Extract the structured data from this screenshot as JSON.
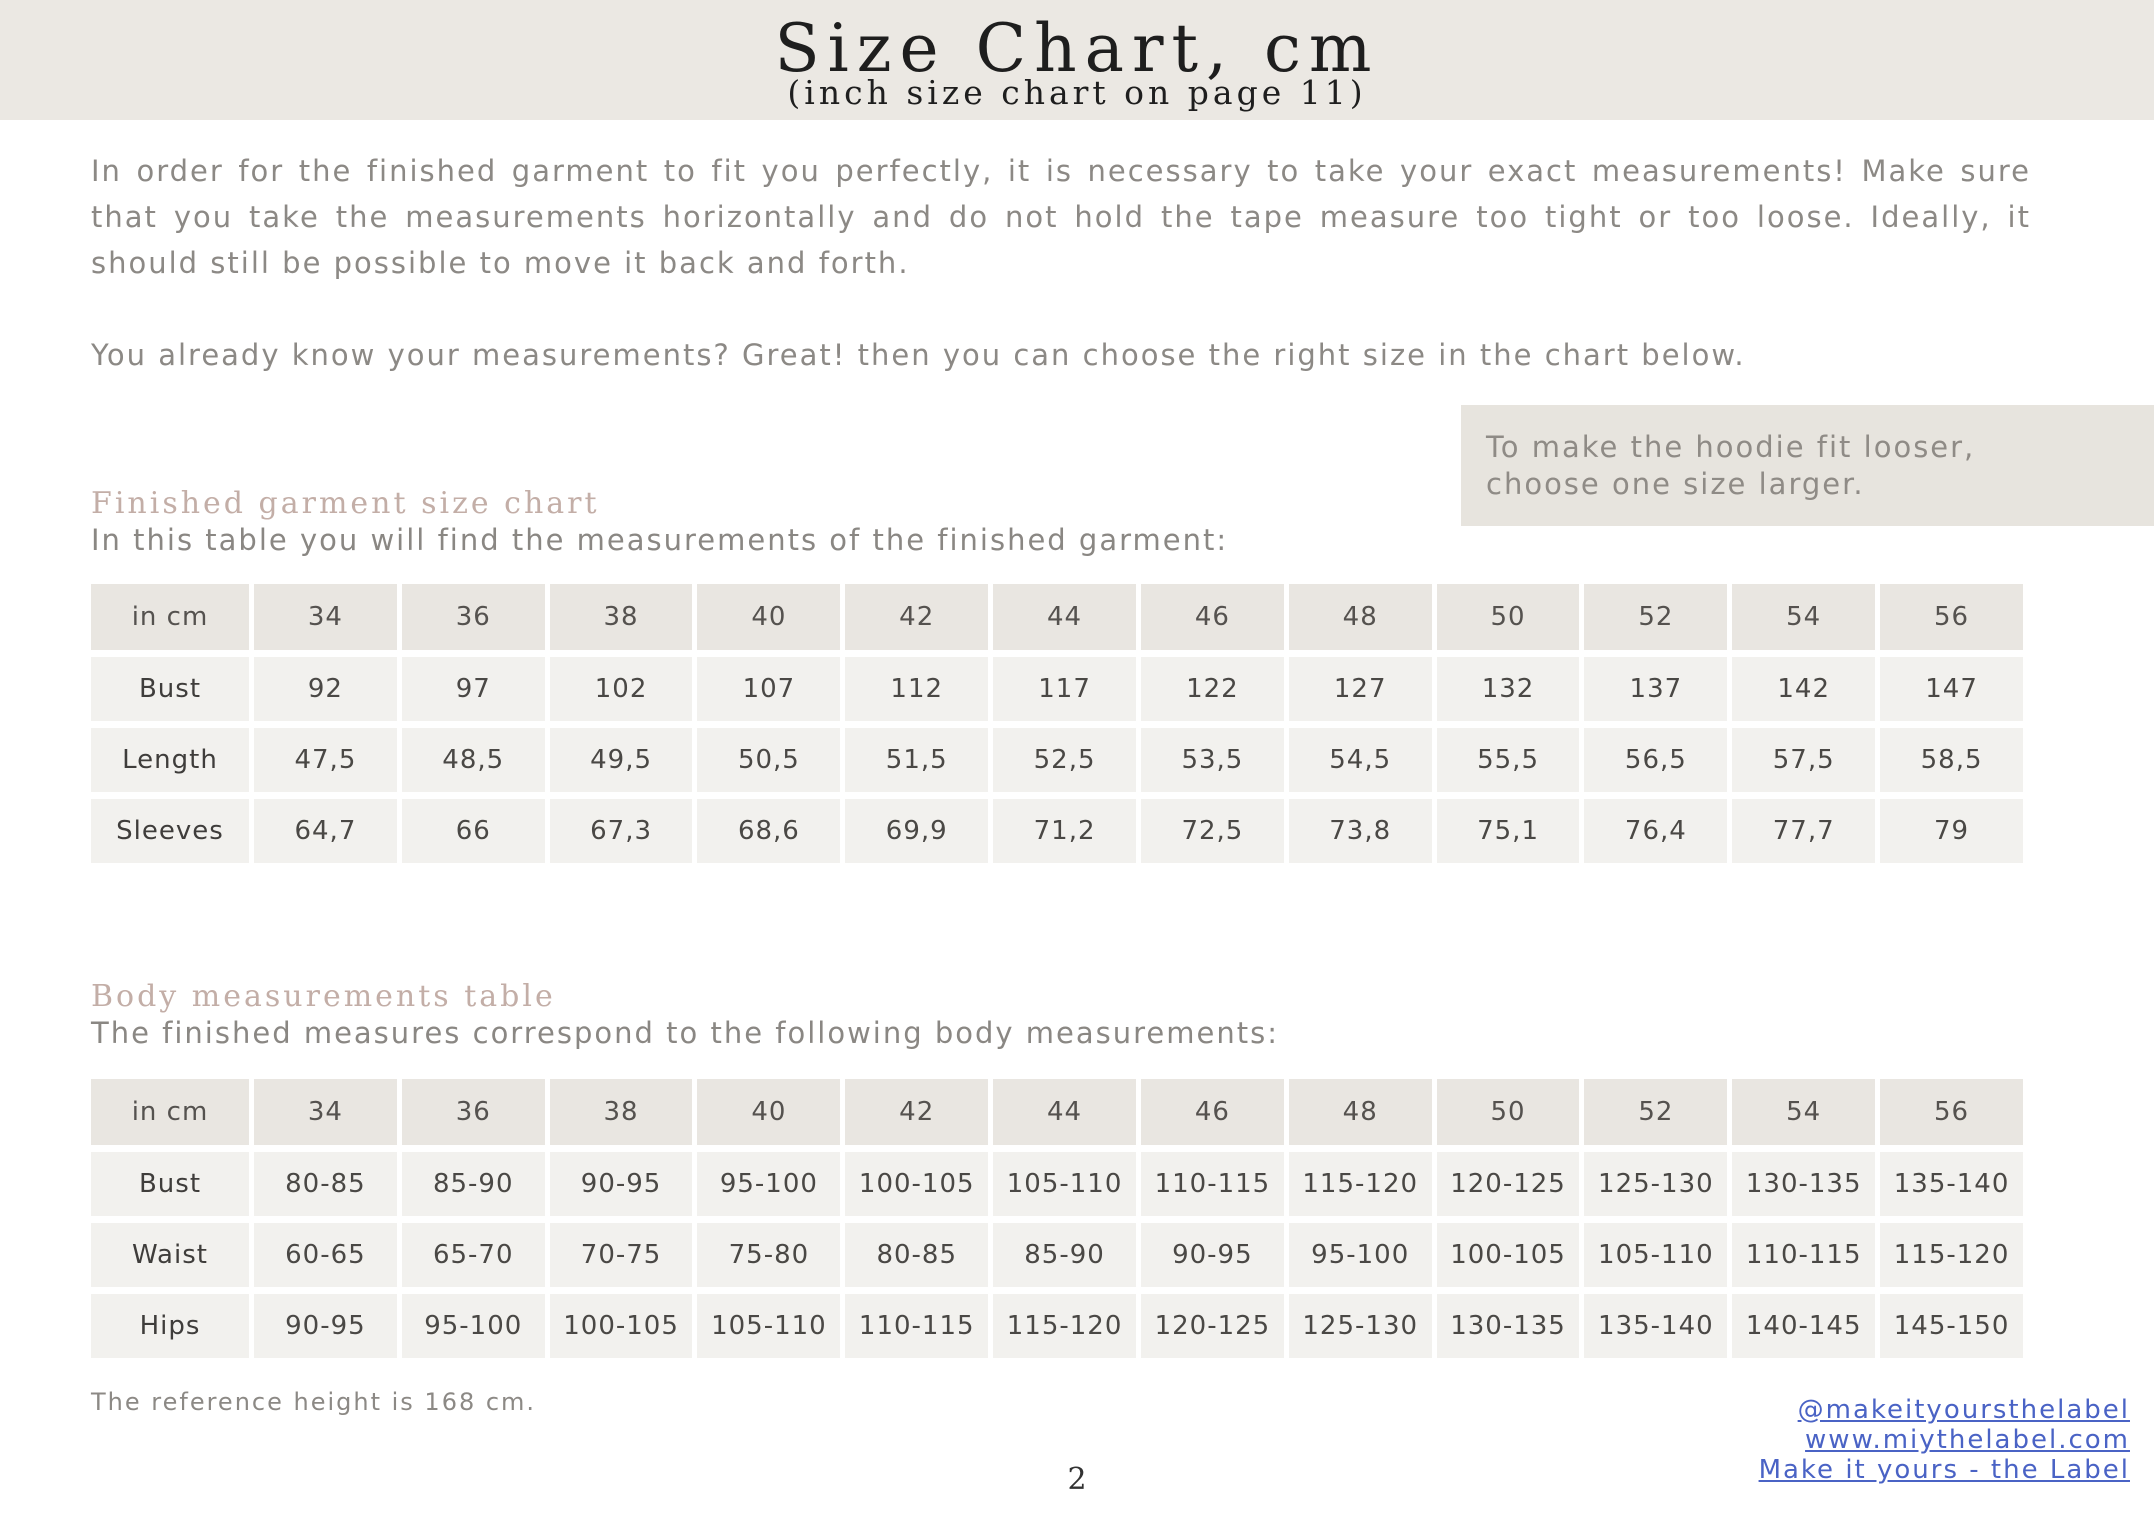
{
  "header": {
    "title": "Size Chart, cm",
    "subtitle": "(inch size chart on page 11)"
  },
  "intro": {
    "paragraph1": "In order for the finished garment to fit you perfectly, it is necessary to take your exact measurements! Make sure that you take the measurements horizontally and do not hold the tape measure too tight or too loose. Ideally, it should still be possible to move it back and forth.",
    "paragraph2": "You already know your measurements? Great! then you can choose the right size in the chart below."
  },
  "note": {
    "text": "To make the hoodie fit looser, choose one size larger."
  },
  "garment_section": {
    "heading": "Finished garment size chart",
    "description": "In this table you will find the measurements of the finished garment:"
  },
  "garment_table": {
    "corner": "in cm",
    "sizes": [
      "34",
      "36",
      "38",
      "40",
      "42",
      "44",
      "46",
      "48",
      "50",
      "52",
      "54",
      "56"
    ],
    "rows": [
      {
        "label": "Bust",
        "values": [
          "92",
          "97",
          "102",
          "107",
          "112",
          "117",
          "122",
          "127",
          "132",
          "137",
          "142",
          "147"
        ]
      },
      {
        "label": "Length",
        "values": [
          "47,5",
          "48,5",
          "49,5",
          "50,5",
          "51,5",
          "52,5",
          "53,5",
          "54,5",
          "55,5",
          "56,5",
          "57,5",
          "58,5"
        ]
      },
      {
        "label": "Sleeves",
        "values": [
          "64,7",
          "66",
          "67,3",
          "68,6",
          "69,9",
          "71,2",
          "72,5",
          "73,8",
          "75,1",
          "76,4",
          "77,7",
          "79"
        ]
      }
    ]
  },
  "body_section": {
    "heading": "Body measurements table",
    "description": "The finished measures correspond to the following body measurements:"
  },
  "body_table": {
    "corner": "in cm",
    "sizes": [
      "34",
      "36",
      "38",
      "40",
      "42",
      "44",
      "46",
      "48",
      "50",
      "52",
      "54",
      "56"
    ],
    "rows": [
      {
        "label": "Bust",
        "values": [
          "80-85",
          "85-90",
          "90-95",
          "95-100",
          "100-105",
          "105-110",
          "110-115",
          "115-120",
          "120-125",
          "125-130",
          "130-135",
          "135-140"
        ]
      },
      {
        "label": "Waist",
        "values": [
          "60-65",
          "65-70",
          "70-75",
          "75-80",
          "80-85",
          "85-90",
          "90-95",
          "95-100",
          "100-105",
          "105-110",
          "110-115",
          "115-120"
        ]
      },
      {
        "label": "Hips",
        "values": [
          "90-95",
          "95-100",
          "100-105",
          "105-110",
          "110-115",
          "115-120",
          "120-125",
          "125-130",
          "130-135",
          "135-140",
          "140-145",
          "145-150"
        ]
      }
    ]
  },
  "footnote": "The reference height is 168 cm.",
  "page_number": "2",
  "links": [
    "@makeityoursthelabel",
    "www.miythelabel.com",
    "Make it yours - the Label"
  ],
  "colors": {
    "header_band": "#ebe8e3",
    "section_heading": "#c3aea7",
    "note_box": "#e7e4de",
    "link": "#4a63c5"
  }
}
